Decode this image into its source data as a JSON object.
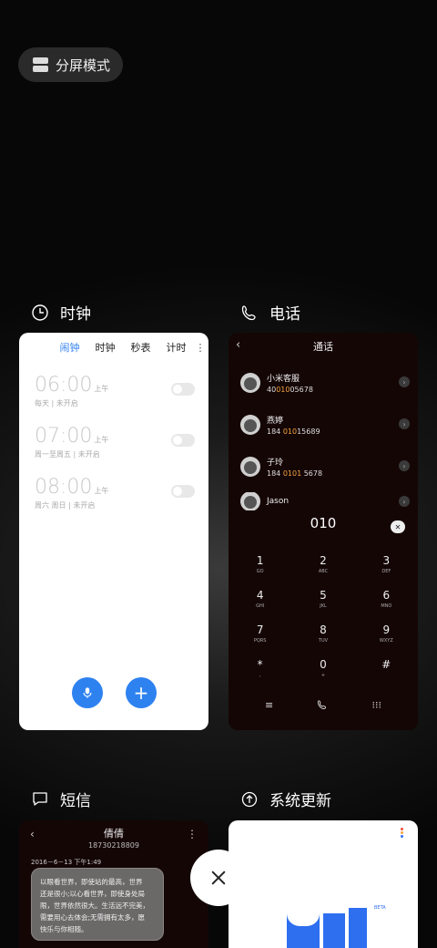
{
  "split_mode": {
    "label": "分屏模式"
  },
  "apps": {
    "clock": {
      "name": "时钟",
      "tabs": [
        "闹钟",
        "时钟",
        "秒表",
        "计时"
      ],
      "alarms": [
        {
          "time": "06:00",
          "ampm": "上午",
          "sub": "每天 | 未开启"
        },
        {
          "time": "07:00",
          "ampm": "上午",
          "sub": "周一至周五 | 未开启"
        },
        {
          "time": "08:00",
          "ampm": "上午",
          "sub": "周六 周日 | 未开启"
        }
      ]
    },
    "phone": {
      "name": "电话",
      "title": "通话",
      "contacts": [
        {
          "name": "小米客服",
          "num_pre": "40",
          "num_hl": "010",
          "num_post": "05678"
        },
        {
          "name": "燕婷",
          "num_pre": "184 ",
          "num_hl": "010",
          "num_post": "15689"
        },
        {
          "name": "子玲",
          "num_pre": "184 ",
          "num_hl": "0101",
          "num_post": " 5678"
        },
        {
          "name": "Jason",
          "num_pre": "",
          "num_hl": "",
          "num_post": ""
        }
      ],
      "dialed": "010",
      "keys": [
        {
          "d": "1",
          "l": "GO"
        },
        {
          "d": "2",
          "l": "ABC"
        },
        {
          "d": "3",
          "l": "DEF"
        },
        {
          "d": "4",
          "l": "GHI"
        },
        {
          "d": "5",
          "l": "JKL"
        },
        {
          "d": "6",
          "l": "MNO"
        },
        {
          "d": "7",
          "l": "PQRS"
        },
        {
          "d": "8",
          "l": "TUV"
        },
        {
          "d": "9",
          "l": "WXYZ"
        },
        {
          "d": "*",
          "l": ","
        },
        {
          "d": "0",
          "l": "+"
        },
        {
          "d": "#",
          "l": ""
        }
      ]
    },
    "sms": {
      "name": "短信",
      "contact_name": "倩倩",
      "contact_number": "18730218809",
      "date": "2016－6－13 下午1:49",
      "message_lines": [
        "以眼看世界，即使站的最高，世界",
        "还是很小;以心看世界，即使身处局",
        "限，世界依然很大。生活远不完美，",
        "需要用心去体会;无需拥有太多，愿",
        "快乐与你相随。"
      ]
    },
    "update": {
      "name": "系统更新",
      "badge": "BETA"
    }
  },
  "colors": {
    "accent": "#2e7ff0",
    "highlight": "#f4a340",
    "fab": "#2e82f0"
  }
}
